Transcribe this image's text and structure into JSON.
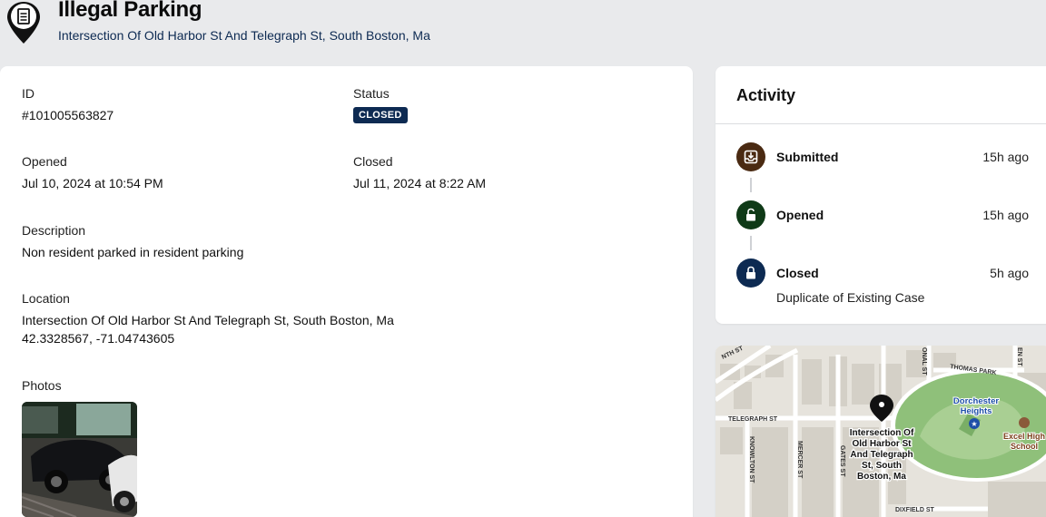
{
  "header": {
    "title": "Illegal Parking",
    "address": "Intersection Of Old Harbor St And Telegraph St, South Boston, Ma"
  },
  "details": {
    "id_label": "ID",
    "id_value": "#101005563827",
    "status_label": "Status",
    "status_value": "CLOSED",
    "opened_label": "Opened",
    "opened_value": "Jul 10, 2024 at 10:54 PM",
    "closed_label": "Closed",
    "closed_value": "Jul 11, 2024 at 8:22 AM",
    "description_label": "Description",
    "description_value": "Non resident parked in resident parking",
    "location_label": "Location",
    "location_address": "Intersection Of Old Harbor St And Telegraph St, South Boston, Ma",
    "location_coords": "42.3328567, -71.04743605",
    "photos_label": "Photos"
  },
  "activity": {
    "title": "Activity",
    "items": [
      {
        "label": "Submitted",
        "time": "15h ago",
        "icon": "inbox-icon",
        "color": "#4a2a12"
      },
      {
        "label": "Opened",
        "time": "15h ago",
        "icon": "unlock-icon",
        "color": "#0f3a17"
      },
      {
        "label": "Closed",
        "time": "5h ago",
        "icon": "lock-icon",
        "color": "#0d2a52"
      }
    ],
    "closed_note": "Duplicate of Existing Case"
  },
  "map": {
    "streets": [
      "TELEGRAPH ST",
      "KNOWLTON ST",
      "MERCER ST",
      "GATES ST",
      "THOMAS PARK",
      "DIXFIELD ST",
      "NTH ST",
      "ONAL ST",
      "EN ST"
    ],
    "pin_label_lines": [
      "Intersection Of",
      "Old Harbor St",
      "And Telegraph",
      "St, South",
      "Boston, Ma"
    ],
    "park_label_lines": [
      "Dorchester",
      "Heights"
    ],
    "school_label_lines": [
      "Excel High",
      "School"
    ],
    "colors": {
      "park": "#8fc07a",
      "street": "#ffffff",
      "block": "#e6e3dc",
      "water_text": "#1e4fa8"
    }
  }
}
